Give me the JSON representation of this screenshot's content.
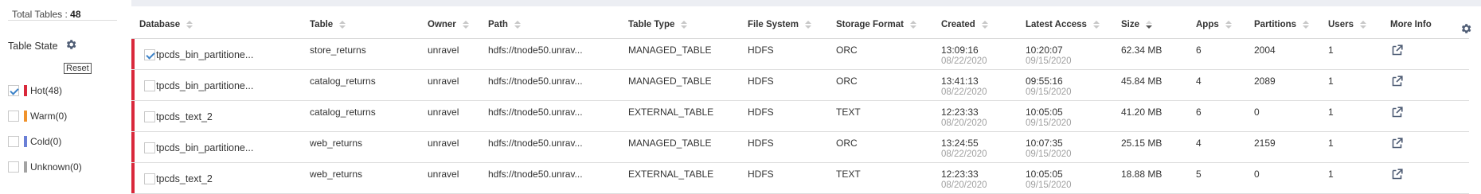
{
  "sidebar": {
    "total_label": "Total Tables : ",
    "total_value": "48",
    "state_title": "Table State",
    "reset_label": "Reset",
    "states": [
      {
        "label": "Hot(48)",
        "color": "#d9283b",
        "checked": true
      },
      {
        "label": "Warm(0)",
        "color": "#f0922b",
        "checked": false
      },
      {
        "label": "Cold(0)",
        "color": "#6a7fd6",
        "checked": false
      },
      {
        "label": "Unknown(0)",
        "color": "#a3a3a3",
        "checked": false
      }
    ]
  },
  "table": {
    "columns": [
      {
        "key": "database",
        "label": "Database",
        "sort": "none"
      },
      {
        "key": "table",
        "label": "Table",
        "sort": "none"
      },
      {
        "key": "owner",
        "label": "Owner",
        "sort": "none"
      },
      {
        "key": "path",
        "label": "Path",
        "sort": "none"
      },
      {
        "key": "table_type",
        "label": "Table Type",
        "sort": "none"
      },
      {
        "key": "file_system",
        "label": "File System",
        "sort": "none"
      },
      {
        "key": "storage_format",
        "label": "Storage Format",
        "sort": "none"
      },
      {
        "key": "created",
        "label": "Created",
        "sort": "none"
      },
      {
        "key": "latest_access",
        "label": "Latest Access",
        "sort": "none"
      },
      {
        "key": "size",
        "label": "Size",
        "sort": "desc"
      },
      {
        "key": "apps",
        "label": "Apps",
        "sort": "none"
      },
      {
        "key": "partitions",
        "label": "Partitions",
        "sort": "none"
      },
      {
        "key": "users",
        "label": "Users",
        "sort": "none"
      },
      {
        "key": "more_info",
        "label": "More Info",
        "sort": null
      }
    ],
    "rows": [
      {
        "checked": true,
        "database": "tpcds_bin_partitione...",
        "table": "store_returns",
        "owner": "unravel",
        "path": "hdfs://tnode50.unrav...",
        "table_type": "MANAGED_TABLE",
        "file_system": "HDFS",
        "storage_format": "ORC",
        "created_time": "13:09:16",
        "created_date": "08/22/2020",
        "access_time": "10:20:07",
        "access_date": "09/15/2020",
        "size": "62.34 MB",
        "apps": "6",
        "partitions": "2004",
        "users": "1",
        "more_icon": "external-link-icon"
      },
      {
        "checked": false,
        "database": "tpcds_bin_partitione...",
        "table": "catalog_returns",
        "owner": "unravel",
        "path": "hdfs://tnode50.unrav...",
        "table_type": "MANAGED_TABLE",
        "file_system": "HDFS",
        "storage_format": "ORC",
        "created_time": "13:41:13",
        "created_date": "08/22/2020",
        "access_time": "09:55:16",
        "access_date": "09/15/2020",
        "size": "45.84 MB",
        "apps": "4",
        "partitions": "2089",
        "users": "1",
        "more_icon": "external-link-icon"
      },
      {
        "checked": false,
        "database": "tpcds_text_2",
        "table": "catalog_returns",
        "owner": "unravel",
        "path": "hdfs://tnode50.unrav...",
        "table_type": "EXTERNAL_TABLE",
        "file_system": "HDFS",
        "storage_format": "TEXT",
        "created_time": "12:23:33",
        "created_date": "08/20/2020",
        "access_time": "10:05:05",
        "access_date": "09/15/2020",
        "size": "41.20 MB",
        "apps": "6",
        "partitions": "0",
        "users": "1",
        "more_icon": "external-link-icon"
      },
      {
        "checked": false,
        "database": "tpcds_bin_partitione...",
        "table": "web_returns",
        "owner": "unravel",
        "path": "hdfs://tnode50.unrav...",
        "table_type": "MANAGED_TABLE",
        "file_system": "HDFS",
        "storage_format": "ORC",
        "created_time": "13:24:55",
        "created_date": "08/22/2020",
        "access_time": "10:07:35",
        "access_date": "09/15/2020",
        "size": "25.15 MB",
        "apps": "4",
        "partitions": "2159",
        "users": "1",
        "more_icon": "external-link-icon"
      },
      {
        "checked": false,
        "database": "tpcds_text_2",
        "table": "web_returns",
        "owner": "unravel",
        "path": "hdfs://tnode50.unrav...",
        "table_type": "EXTERNAL_TABLE",
        "file_system": "HDFS",
        "storage_format": "TEXT",
        "created_time": "12:23:33",
        "created_date": "08/20/2020",
        "access_time": "10:05:05",
        "access_date": "09/15/2020",
        "size": "18.88 MB",
        "apps": "5",
        "partitions": "0",
        "users": "1",
        "more_icon": "external-link-icon"
      }
    ]
  },
  "icons": {
    "state_settings": "gear-icon",
    "table_settings": "gear-icon"
  },
  "colors": {
    "hot": "#d9283b",
    "accent": "#3c82c8"
  }
}
